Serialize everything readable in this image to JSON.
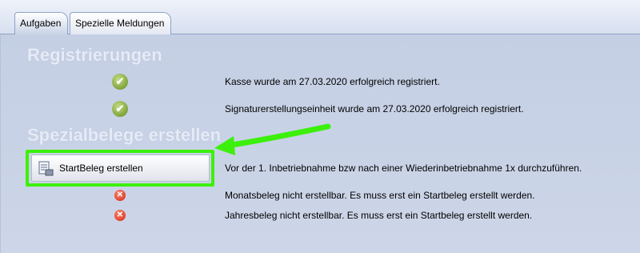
{
  "tabs": [
    {
      "label": "Aufgaben",
      "active": true
    },
    {
      "label": "Spezielle Meldungen",
      "active": false
    }
  ],
  "registrierungen": {
    "title": "Registrierungen",
    "rows": [
      {
        "icon": "check-icon",
        "text": "Kasse wurde am 27.03.2020 erfolgreich registriert."
      },
      {
        "icon": "check-icon",
        "text": "Signaturerstellungseinheit wurde am 27.03.2020 erfolgreich registriert."
      }
    ]
  },
  "spezialbelege": {
    "title": "Spezialbelege erstellen",
    "start_button_label": "StartBeleg erstellen",
    "start_description": "Vor der 1. Inbetriebnahme bzw nach einer Wiederinbetriebnahme 1x durchzuführen.",
    "rows": [
      {
        "icon": "error-icon",
        "text": "Monatsbeleg nicht erstellbar. Es muss erst ein Startbeleg erstellt werden."
      },
      {
        "icon": "error-icon",
        "text": "Jahresbeleg nicht erstellbar. Es muss erst ein Startbeleg erstellt werden."
      }
    ]
  },
  "colors": {
    "background": "#c9d3e6",
    "section_title": "#e6ebf6",
    "highlight": "#3cf00c",
    "success": "#7fa43b",
    "error": "#e0412a"
  },
  "icons": {
    "check": "✔",
    "error": "✕"
  }
}
